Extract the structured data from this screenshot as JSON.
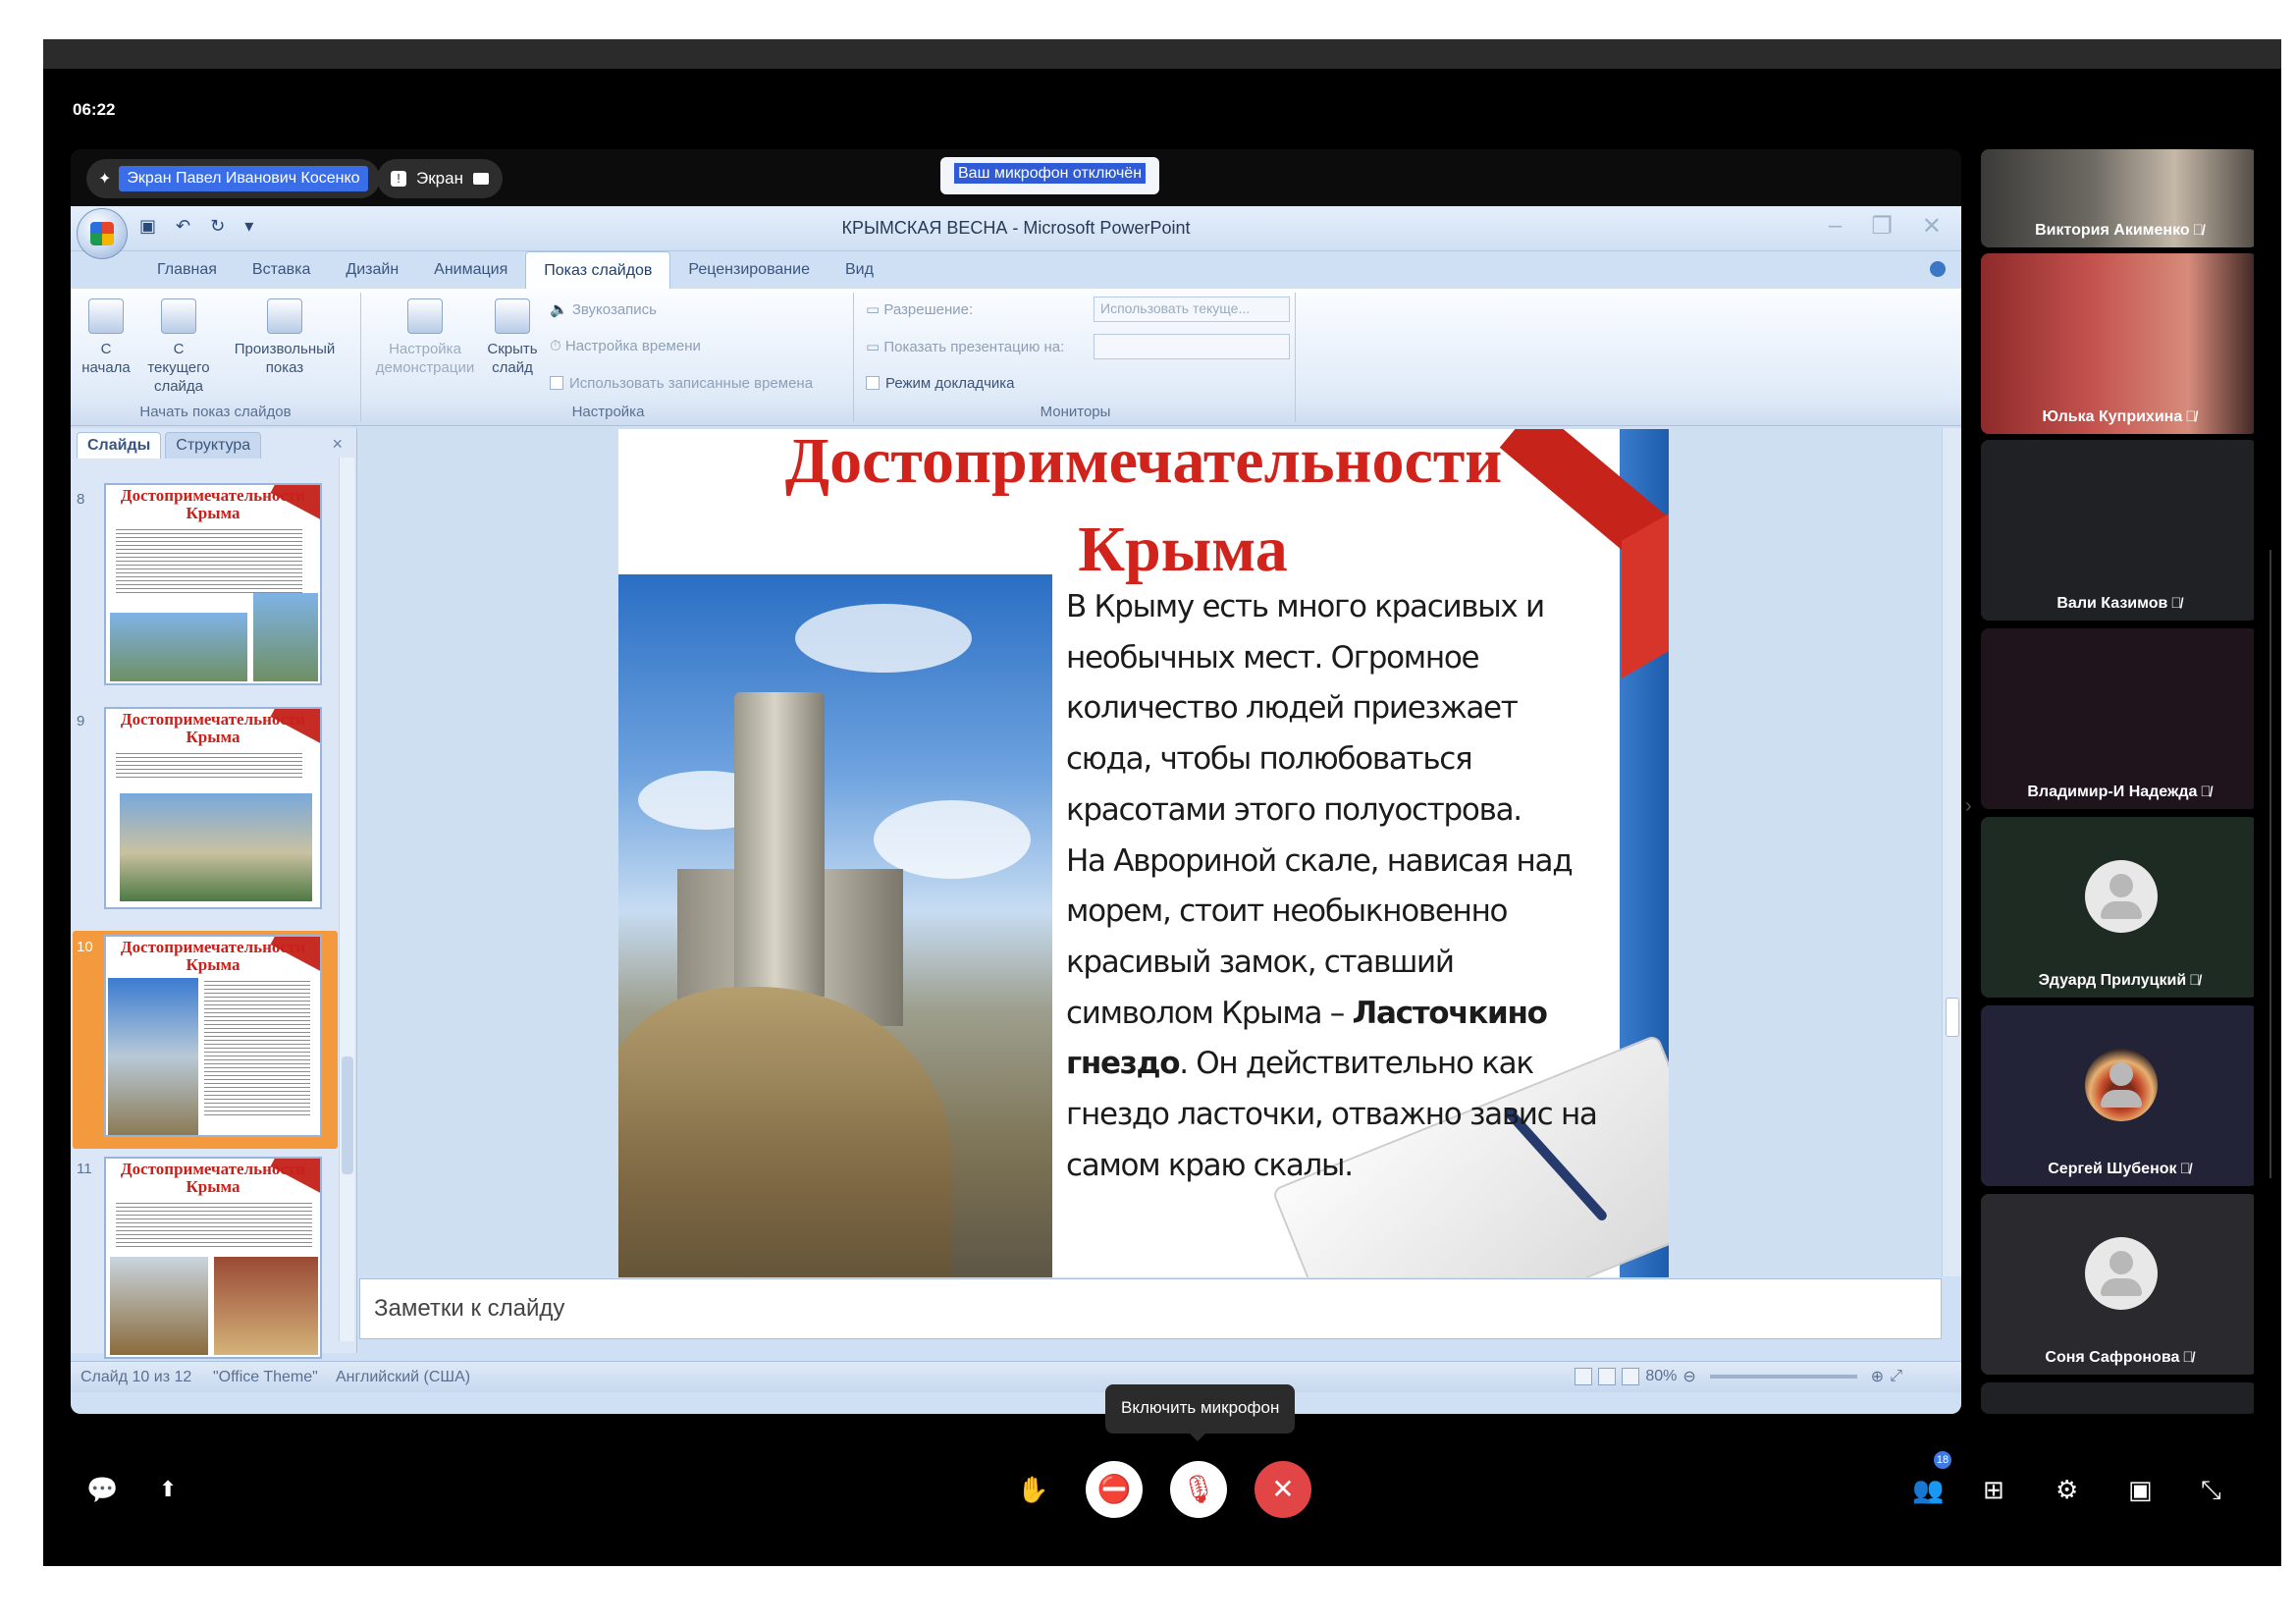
{
  "clock": "06:22",
  "share": {
    "presenter_label": "Экран Павел Иванович Косенко",
    "screen_label": "Экран",
    "mic_disabled_notice": "Ваш микрофон отключён"
  },
  "powerpoint": {
    "window_title": "КРЫМСКАЯ ВЕСНА - Microsoft PowerPoint",
    "tabs": [
      "Главная",
      "Вставка",
      "Дизайн",
      "Анимация",
      "Показ слайдов",
      "Рецензирование",
      "Вид"
    ],
    "active_tab": "Показ слайдов",
    "ribbon": {
      "start_group": {
        "label": "Начать показ слайдов",
        "from_start": "С начала",
        "from_current": "С текущего слайда",
        "custom_show": "Произвольный показ"
      },
      "setup_group": {
        "label": "Настройка",
        "setup_show": "Настройка демонстрации",
        "hide_slide": "Скрыть слайд",
        "record_narration": "Звукозапись",
        "rehearse_timings": "Настройка времени",
        "use_timings": "Использовать записанные времена"
      },
      "monitors_group": {
        "label": "Мониторы",
        "resolution_label": "Разрешение:",
        "resolution_value": "Использовать текуще...",
        "show_on_label": "Показать презентацию на:",
        "presenter_view": "Режим докладчика"
      }
    },
    "panel_tabs": [
      "Слайды",
      "Структура"
    ],
    "thumbnails": [
      {
        "num": "8",
        "title": "Достопримечательности Крыма"
      },
      {
        "num": "9",
        "title": "Достопримечательности Крыма"
      },
      {
        "num": "10",
        "title": "Достопримечательности Крыма"
      },
      {
        "num": "11",
        "title": "Достопримечательности Крыма"
      }
    ],
    "slide": {
      "title_line1": "Достопримечательности",
      "title_line2": "Крыма",
      "para1": "В Крыму есть много красивых и необычных мест. Огромное количество людей приезжает сюда, чтобы полюбоваться красотами этого полуострова.",
      "para2_start": "На Аврориной скале, нависая над морем, стоит необыкновенно красивый замок, ставший символом Крыма – ",
      "para2_bold": "Ласточкино гнездо",
      "para2_end": ". Он действительно как гнездо ласточки, отважно завис на самом краю скалы."
    },
    "notes_placeholder": "Заметки к слайду",
    "status": {
      "slide_counter": "Слайд 10 из 12",
      "theme": "\"Office Theme\"",
      "language": "Английский (США)",
      "zoom": "80%"
    }
  },
  "participants": [
    {
      "name": "Виктория Акименко",
      "type": "video"
    },
    {
      "name": "Юлька Куприхина",
      "type": "video"
    },
    {
      "name": "Вали Казимов",
      "type": "blank"
    },
    {
      "name": "Владимир-И Надежда",
      "type": "blank"
    },
    {
      "name": "Эдуард Прилуцкий",
      "type": "avatar"
    },
    {
      "name": "Сергей Шубенок",
      "type": "custom-avatar"
    },
    {
      "name": "Соня Сафронова",
      "type": "avatar"
    }
  ],
  "toolbar": {
    "mic_tooltip": "Включить микрофон",
    "participants_badge": "18"
  }
}
